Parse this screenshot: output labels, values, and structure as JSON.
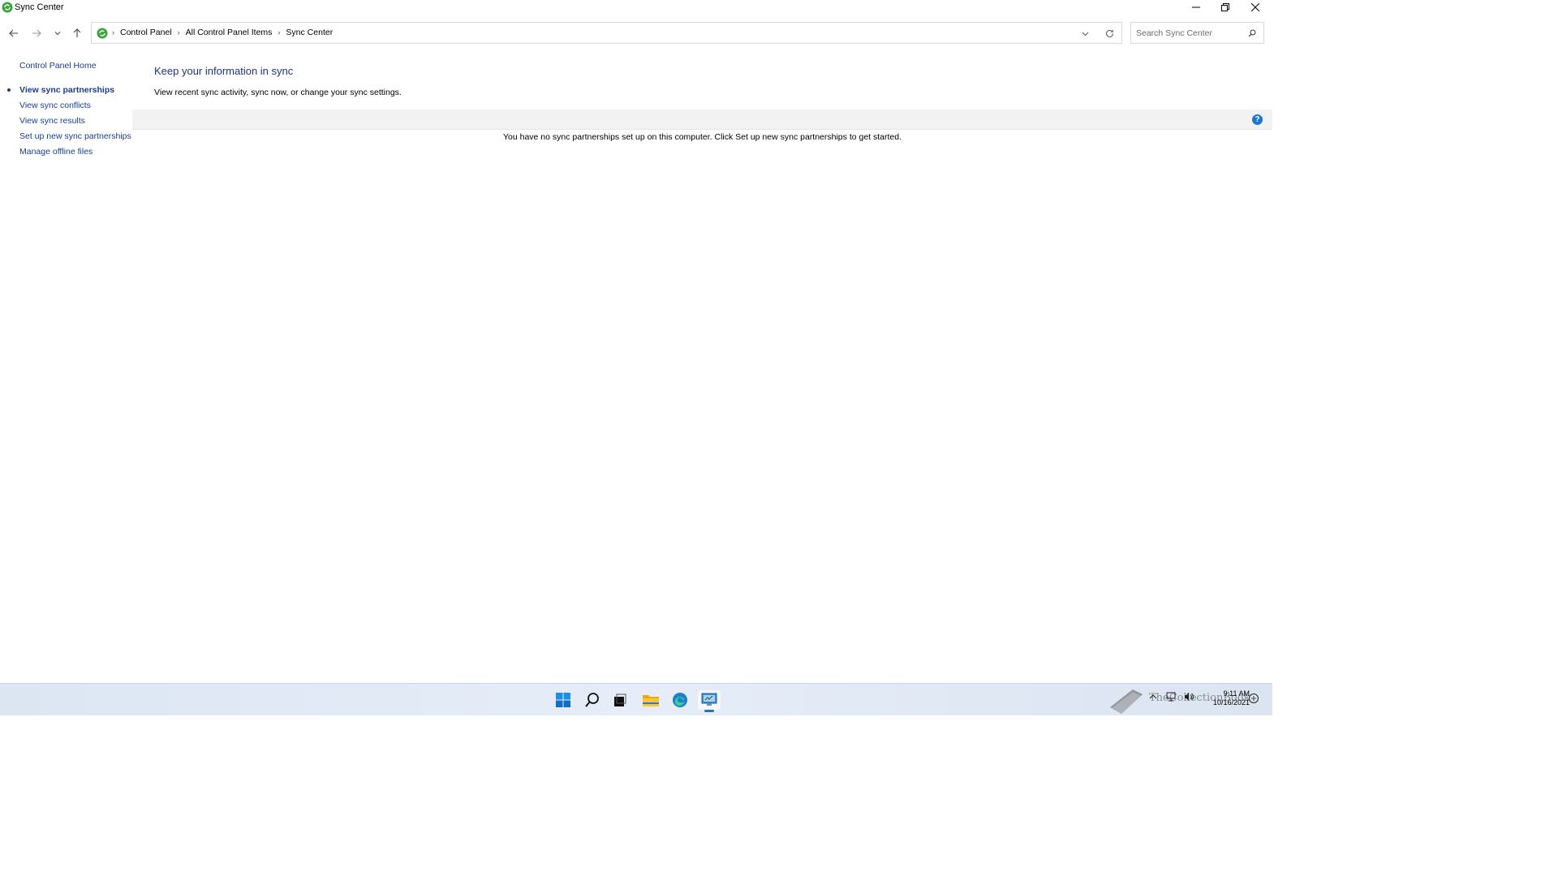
{
  "window": {
    "title": "Sync Center"
  },
  "breadcrumb": {
    "items": [
      "Control Panel",
      "All Control Panel Items",
      "Sync Center"
    ]
  },
  "search": {
    "placeholder": "Search Sync Center"
  },
  "sidebar": {
    "home": "Control Panel Home",
    "items": [
      {
        "label": "View sync partnerships",
        "active": true
      },
      {
        "label": "View sync conflicts",
        "active": false
      },
      {
        "label": "View sync results",
        "active": false
      },
      {
        "label": "Set up new sync partnerships",
        "active": false
      },
      {
        "label": "Manage offline files",
        "active": false
      }
    ]
  },
  "main": {
    "title": "Keep your information in sync",
    "description": "View recent sync activity, sync now, or change your sync settings.",
    "empty_message": "You have no sync partnerships set up on this computer. Click Set up new sync partnerships to get started.",
    "help_glyph": "?"
  },
  "taskbar": {
    "apps": [
      "start-icon",
      "search-icon",
      "task-view-icon",
      "file-explorer-icon",
      "edge-icon",
      "control-panel-icon"
    ],
    "clock_time": "9:11 AM",
    "clock_date": "10/16/2021",
    "watermark_text": "TheCollectionBook"
  },
  "colors": {
    "link": "#1a3d8f",
    "heading": "#1e3287",
    "sync_icon": "#3aa53a",
    "help": "#1f74d4",
    "taskbar": "#dce6f3"
  }
}
